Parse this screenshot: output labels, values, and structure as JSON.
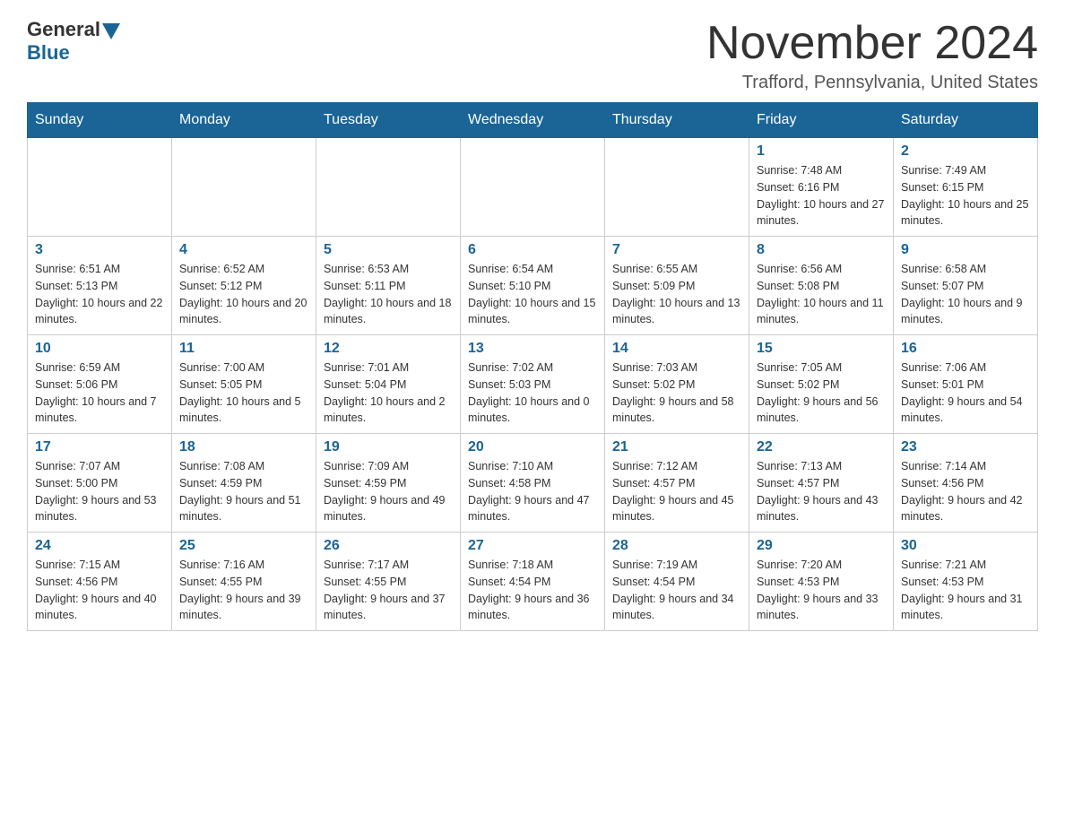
{
  "logo": {
    "general": "General",
    "blue": "Blue"
  },
  "header": {
    "title": "November 2024",
    "location": "Trafford, Pennsylvania, United States"
  },
  "days_of_week": [
    "Sunday",
    "Monday",
    "Tuesday",
    "Wednesday",
    "Thursday",
    "Friday",
    "Saturday"
  ],
  "weeks": [
    [
      {
        "day": "",
        "info": ""
      },
      {
        "day": "",
        "info": ""
      },
      {
        "day": "",
        "info": ""
      },
      {
        "day": "",
        "info": ""
      },
      {
        "day": "",
        "info": ""
      },
      {
        "day": "1",
        "info": "Sunrise: 7:48 AM\nSunset: 6:16 PM\nDaylight: 10 hours and 27 minutes."
      },
      {
        "day": "2",
        "info": "Sunrise: 7:49 AM\nSunset: 6:15 PM\nDaylight: 10 hours and 25 minutes."
      }
    ],
    [
      {
        "day": "3",
        "info": "Sunrise: 6:51 AM\nSunset: 5:13 PM\nDaylight: 10 hours and 22 minutes."
      },
      {
        "day": "4",
        "info": "Sunrise: 6:52 AM\nSunset: 5:12 PM\nDaylight: 10 hours and 20 minutes."
      },
      {
        "day": "5",
        "info": "Sunrise: 6:53 AM\nSunset: 5:11 PM\nDaylight: 10 hours and 18 minutes."
      },
      {
        "day": "6",
        "info": "Sunrise: 6:54 AM\nSunset: 5:10 PM\nDaylight: 10 hours and 15 minutes."
      },
      {
        "day": "7",
        "info": "Sunrise: 6:55 AM\nSunset: 5:09 PM\nDaylight: 10 hours and 13 minutes."
      },
      {
        "day": "8",
        "info": "Sunrise: 6:56 AM\nSunset: 5:08 PM\nDaylight: 10 hours and 11 minutes."
      },
      {
        "day": "9",
        "info": "Sunrise: 6:58 AM\nSunset: 5:07 PM\nDaylight: 10 hours and 9 minutes."
      }
    ],
    [
      {
        "day": "10",
        "info": "Sunrise: 6:59 AM\nSunset: 5:06 PM\nDaylight: 10 hours and 7 minutes."
      },
      {
        "day": "11",
        "info": "Sunrise: 7:00 AM\nSunset: 5:05 PM\nDaylight: 10 hours and 5 minutes."
      },
      {
        "day": "12",
        "info": "Sunrise: 7:01 AM\nSunset: 5:04 PM\nDaylight: 10 hours and 2 minutes."
      },
      {
        "day": "13",
        "info": "Sunrise: 7:02 AM\nSunset: 5:03 PM\nDaylight: 10 hours and 0 minutes."
      },
      {
        "day": "14",
        "info": "Sunrise: 7:03 AM\nSunset: 5:02 PM\nDaylight: 9 hours and 58 minutes."
      },
      {
        "day": "15",
        "info": "Sunrise: 7:05 AM\nSunset: 5:02 PM\nDaylight: 9 hours and 56 minutes."
      },
      {
        "day": "16",
        "info": "Sunrise: 7:06 AM\nSunset: 5:01 PM\nDaylight: 9 hours and 54 minutes."
      }
    ],
    [
      {
        "day": "17",
        "info": "Sunrise: 7:07 AM\nSunset: 5:00 PM\nDaylight: 9 hours and 53 minutes."
      },
      {
        "day": "18",
        "info": "Sunrise: 7:08 AM\nSunset: 4:59 PM\nDaylight: 9 hours and 51 minutes."
      },
      {
        "day": "19",
        "info": "Sunrise: 7:09 AM\nSunset: 4:59 PM\nDaylight: 9 hours and 49 minutes."
      },
      {
        "day": "20",
        "info": "Sunrise: 7:10 AM\nSunset: 4:58 PM\nDaylight: 9 hours and 47 minutes."
      },
      {
        "day": "21",
        "info": "Sunrise: 7:12 AM\nSunset: 4:57 PM\nDaylight: 9 hours and 45 minutes."
      },
      {
        "day": "22",
        "info": "Sunrise: 7:13 AM\nSunset: 4:57 PM\nDaylight: 9 hours and 43 minutes."
      },
      {
        "day": "23",
        "info": "Sunrise: 7:14 AM\nSunset: 4:56 PM\nDaylight: 9 hours and 42 minutes."
      }
    ],
    [
      {
        "day": "24",
        "info": "Sunrise: 7:15 AM\nSunset: 4:56 PM\nDaylight: 9 hours and 40 minutes."
      },
      {
        "day": "25",
        "info": "Sunrise: 7:16 AM\nSunset: 4:55 PM\nDaylight: 9 hours and 39 minutes."
      },
      {
        "day": "26",
        "info": "Sunrise: 7:17 AM\nSunset: 4:55 PM\nDaylight: 9 hours and 37 minutes."
      },
      {
        "day": "27",
        "info": "Sunrise: 7:18 AM\nSunset: 4:54 PM\nDaylight: 9 hours and 36 minutes."
      },
      {
        "day": "28",
        "info": "Sunrise: 7:19 AM\nSunset: 4:54 PM\nDaylight: 9 hours and 34 minutes."
      },
      {
        "day": "29",
        "info": "Sunrise: 7:20 AM\nSunset: 4:53 PM\nDaylight: 9 hours and 33 minutes."
      },
      {
        "day": "30",
        "info": "Sunrise: 7:21 AM\nSunset: 4:53 PM\nDaylight: 9 hours and 31 minutes."
      }
    ]
  ]
}
